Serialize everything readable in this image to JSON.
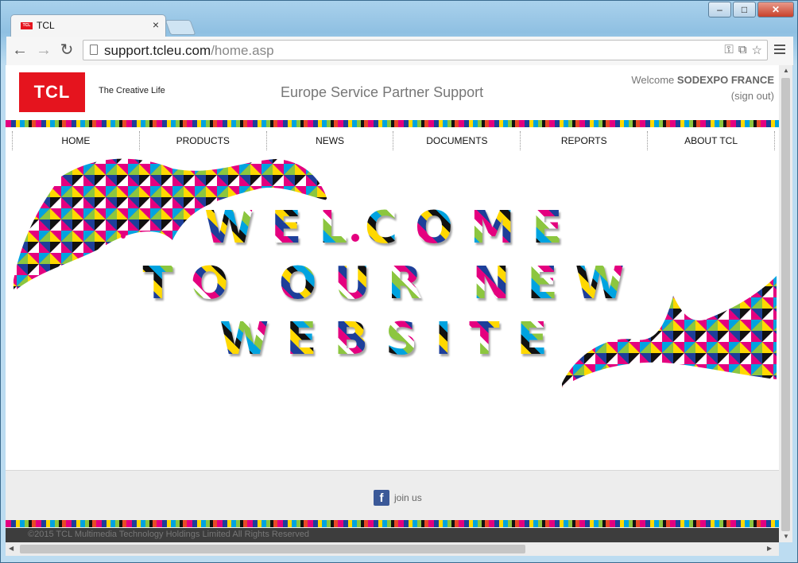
{
  "browser": {
    "tab_title": "TCL",
    "tab_favicon_text": "TCL",
    "url_domain": "support.tcleu.com",
    "url_path": "/home.asp"
  },
  "header": {
    "logo_text": "TCL",
    "tagline": "The Creative Life",
    "site_title": "Europe Service Partner Support",
    "welcome_prefix": "Welcome",
    "user_name": "SODEXPO FRANCE",
    "sign_out": "(sign out)"
  },
  "nav": [
    "HOME",
    "PRODUCTS",
    "NEWS",
    "DOCUMENTS",
    "REPORTS",
    "ABOUT TCL"
  ],
  "hero": {
    "line1": "WELCOME",
    "line2": "TO OUR NEW",
    "line3": "WEBSITE"
  },
  "footer": {
    "join_us": "join us",
    "copyright": "©2015 TCL Multimedia Technology Holdings Limited All Rights Reserved"
  },
  "colors": {
    "brand_red": "#e5141e",
    "facebook_blue": "#3b5998"
  }
}
